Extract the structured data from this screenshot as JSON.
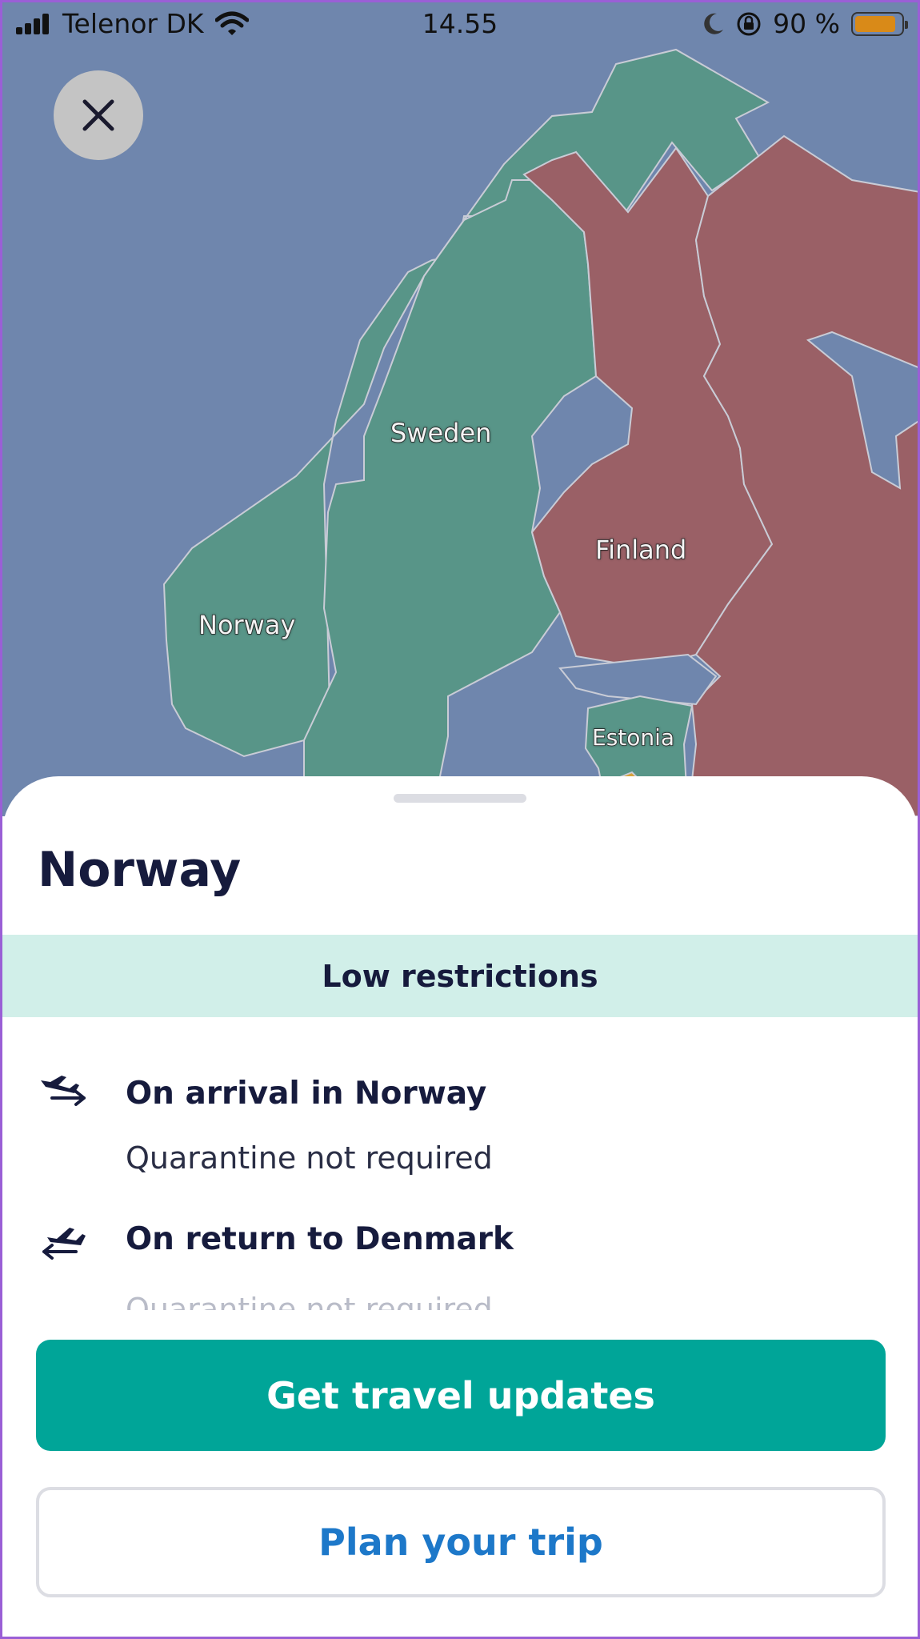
{
  "status_bar": {
    "carrier": "Telenor DK",
    "time": "14.55",
    "battery_percent": "90 %",
    "battery_level": 0.9
  },
  "map": {
    "labels": {
      "sweden": "Sweden",
      "finland": "Finland",
      "norway": "Norway",
      "estonia": "Estonia"
    },
    "colors": {
      "water": "#6f86ad",
      "low_restrictions": "#589588",
      "high_restrictions": "#9a6066"
    }
  },
  "close_button": {
    "icon": "close-icon"
  },
  "sheet": {
    "title": "Norway",
    "restriction_level": "Low restrictions",
    "arrival": {
      "icon": "airplane-arrival-icon",
      "title": "On arrival in Norway",
      "detail": "Quarantine not required"
    },
    "return": {
      "icon": "airplane-departure-icon",
      "title": "On return to Denmark",
      "detail": "Quarantine not required"
    },
    "primary_button": "Get travel updates",
    "secondary_button": "Plan your trip",
    "colors": {
      "accent": "#00a598",
      "link": "#1d78c9",
      "band": "#d1efe9"
    }
  }
}
